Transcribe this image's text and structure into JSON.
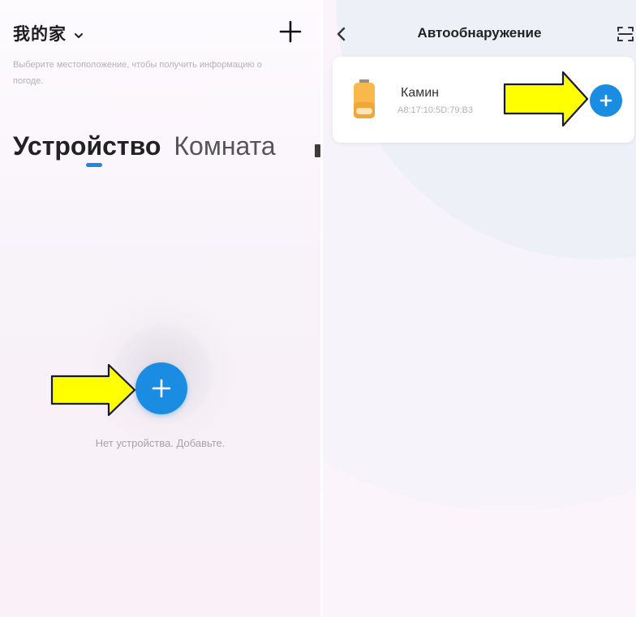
{
  "left_screen": {
    "home_name": "我的家",
    "weather_hint": "Выберите местоположение, чтобы получить информацию о погоде.",
    "tabs": [
      {
        "label": "Устройство",
        "active": true
      },
      {
        "label": "Комната",
        "active": false
      }
    ],
    "empty_message": "Нет устройства. Добавьте.",
    "icons": [
      "chevron-down-icon",
      "plus-icon",
      "add-device-icon",
      "arrow-pointer-icon"
    ]
  },
  "right_screen": {
    "title": "Автообнаружение",
    "device": {
      "name": "Камин",
      "mac": "A8:17:10:5D:79:B3"
    },
    "icons": [
      "back-icon",
      "scan-icon",
      "device-thumbnail-icon",
      "add-icon",
      "arrow-pointer-icon"
    ]
  },
  "colors": {
    "accent": "#1a8de3",
    "arrow_fill": "#ffff00",
    "arrow_stroke": "#1a1a2e",
    "background": "#fbf4fa",
    "device_icon": "#f7b94c"
  }
}
